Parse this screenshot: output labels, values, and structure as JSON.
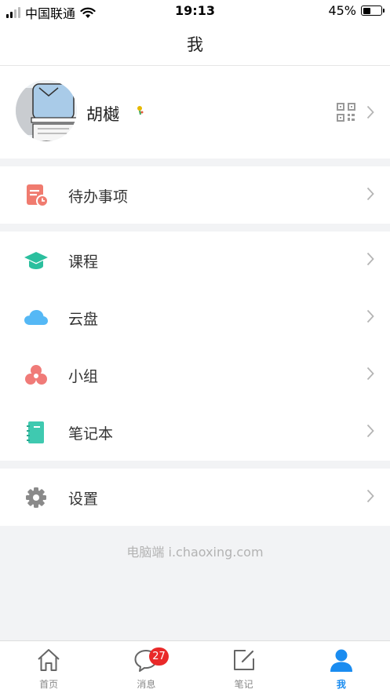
{
  "status_bar": {
    "carrier": "中国联通",
    "time": "19:13",
    "battery": "45%",
    "battery_level": 0.45
  },
  "nav": {
    "title": "我"
  },
  "profile": {
    "name": "胡樾"
  },
  "sections": {
    "todo": {
      "label": "待办事项",
      "icon": "todo-clock-icon"
    },
    "courses": {
      "label": "课程",
      "icon": "graduation-cap-icon"
    },
    "cloud": {
      "label": "云盘",
      "icon": "cloud-icon"
    },
    "group": {
      "label": "小组",
      "icon": "group-icon"
    },
    "notebook": {
      "label": "笔记本",
      "icon": "notebook-icon"
    },
    "settings": {
      "label": "设置",
      "icon": "gear-icon"
    }
  },
  "footer": {
    "text": "电脑端 i.chaoxing.com"
  },
  "tabs": [
    {
      "label": "首页",
      "icon": "home-icon"
    },
    {
      "label": "消息",
      "icon": "message-icon",
      "badge": "27"
    },
    {
      "label": "笔记",
      "icon": "edit-note-icon"
    },
    {
      "label": "我",
      "icon": "user-icon",
      "active": true
    }
  ],
  "colors": {
    "accent": "#1a8cf0",
    "todo": "#f07b6f",
    "course": "#2bbf9e",
    "cloud": "#55b8f5",
    "group": "#f07b78",
    "notebook": "#3fc9b0",
    "settings": "#8a8a8a",
    "badge": "#e92929"
  }
}
